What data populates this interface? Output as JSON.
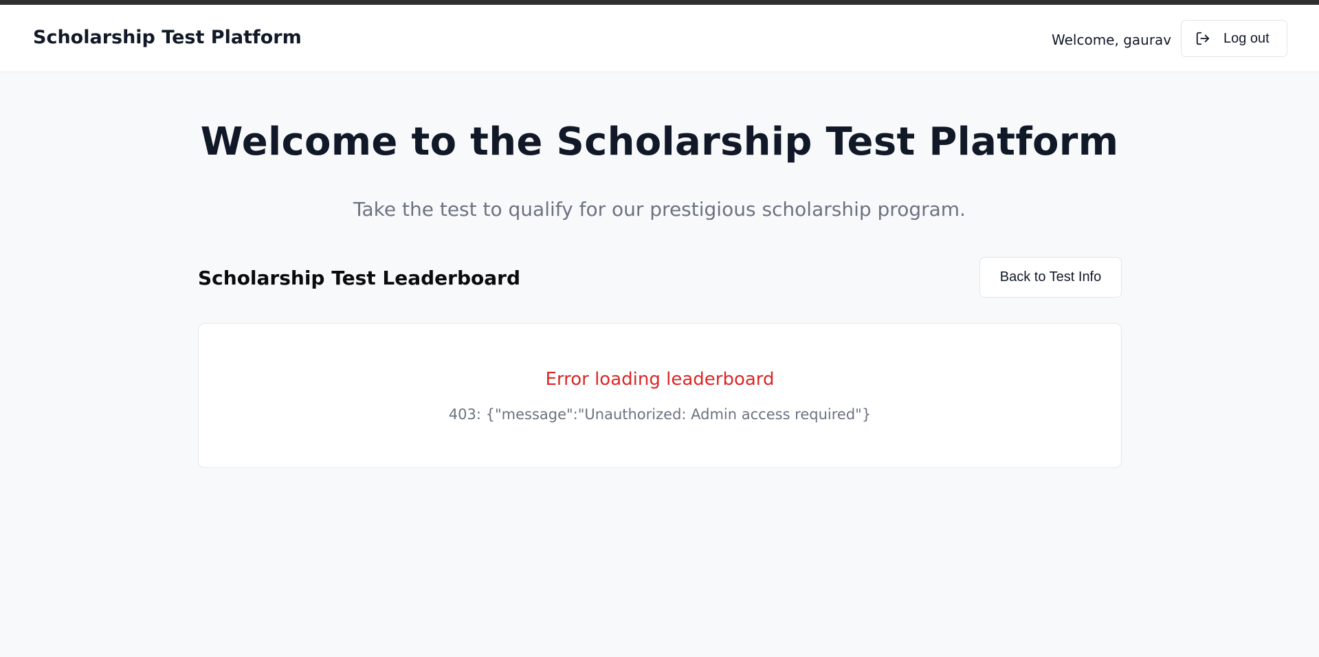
{
  "header": {
    "brand": "Scholarship Test Platform",
    "welcome_text": "Welcome, gaurav",
    "logout_label": "Log out",
    "logout_icon": "log-out-icon"
  },
  "hero": {
    "title": "Welcome to the Scholarship Test Platform",
    "subtitle": "Take the test to qualify for our prestigious scholarship program."
  },
  "leaderboard": {
    "title": "Scholarship Test Leaderboard",
    "back_label": "Back to Test Info",
    "error_title": "Error loading leaderboard",
    "error_detail": "403: {\"message\":\"Unauthorized: Admin access required\"}"
  },
  "colors": {
    "error": "#dc2626",
    "text_primary": "#111827",
    "text_muted": "#6b7280",
    "page_background": "#f8f9fb"
  }
}
